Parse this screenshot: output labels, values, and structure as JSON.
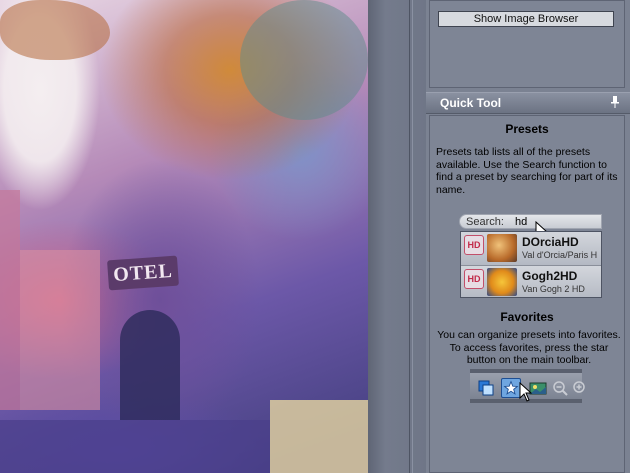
{
  "browser": {
    "button_label": "Show Image Browser"
  },
  "quick_tool": {
    "title": "Quick Tool",
    "presets": {
      "title": "Presets",
      "description": "Presets tab lists all of the presets available. Use the Search function to find a preset by searching for part of its name.",
      "search_label": "Search:",
      "search_value": "hd",
      "items": [
        {
          "badge": "HD",
          "name": "DOrciaHD",
          "subtitle": "Val d'Orcia/Paris H"
        },
        {
          "badge": "HD",
          "name": "Gogh2HD",
          "subtitle": "Van Gogh 2 HD"
        }
      ]
    },
    "favorites": {
      "title": "Favorites",
      "description": "You can organize presets into favorites. To access favorites, press the star button on the main toolbar."
    }
  },
  "canvas": {
    "sign_text": "OTEL"
  },
  "colors": {
    "accent": "#6fa6e0",
    "panel": "#7e8595",
    "badge_red": "#c22b4a"
  },
  "icons": [
    "pin-icon",
    "copy-icon",
    "star-icon",
    "image-icon",
    "zoom-out-icon",
    "zoom-in-icon",
    "cursor-arrow-icon"
  ]
}
